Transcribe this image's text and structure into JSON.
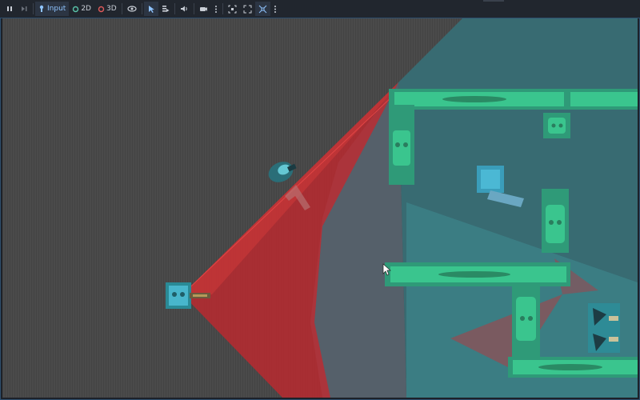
{
  "toolbar": {
    "input_label": "Input",
    "mode_2d_label": "2D",
    "mode_3d_label": "3D"
  },
  "colors": {
    "editor_bg": "#21262e",
    "viewport_floor": "#4b4b4b",
    "wall_teal": "#3a8f94",
    "platform_green": "#35c18a",
    "light_cone": "#cc2a2a",
    "mode_2d": "#59c3a8",
    "mode_3d": "#e05a5a"
  },
  "icons": [
    "pause-icon",
    "step-frame-icon",
    "input-icon",
    "eye-icon",
    "pointer-icon",
    "list-icon",
    "speaker-icon",
    "camera-icon",
    "more-icon",
    "focus-icon",
    "fullscreen-icon",
    "fit-icon"
  ]
}
